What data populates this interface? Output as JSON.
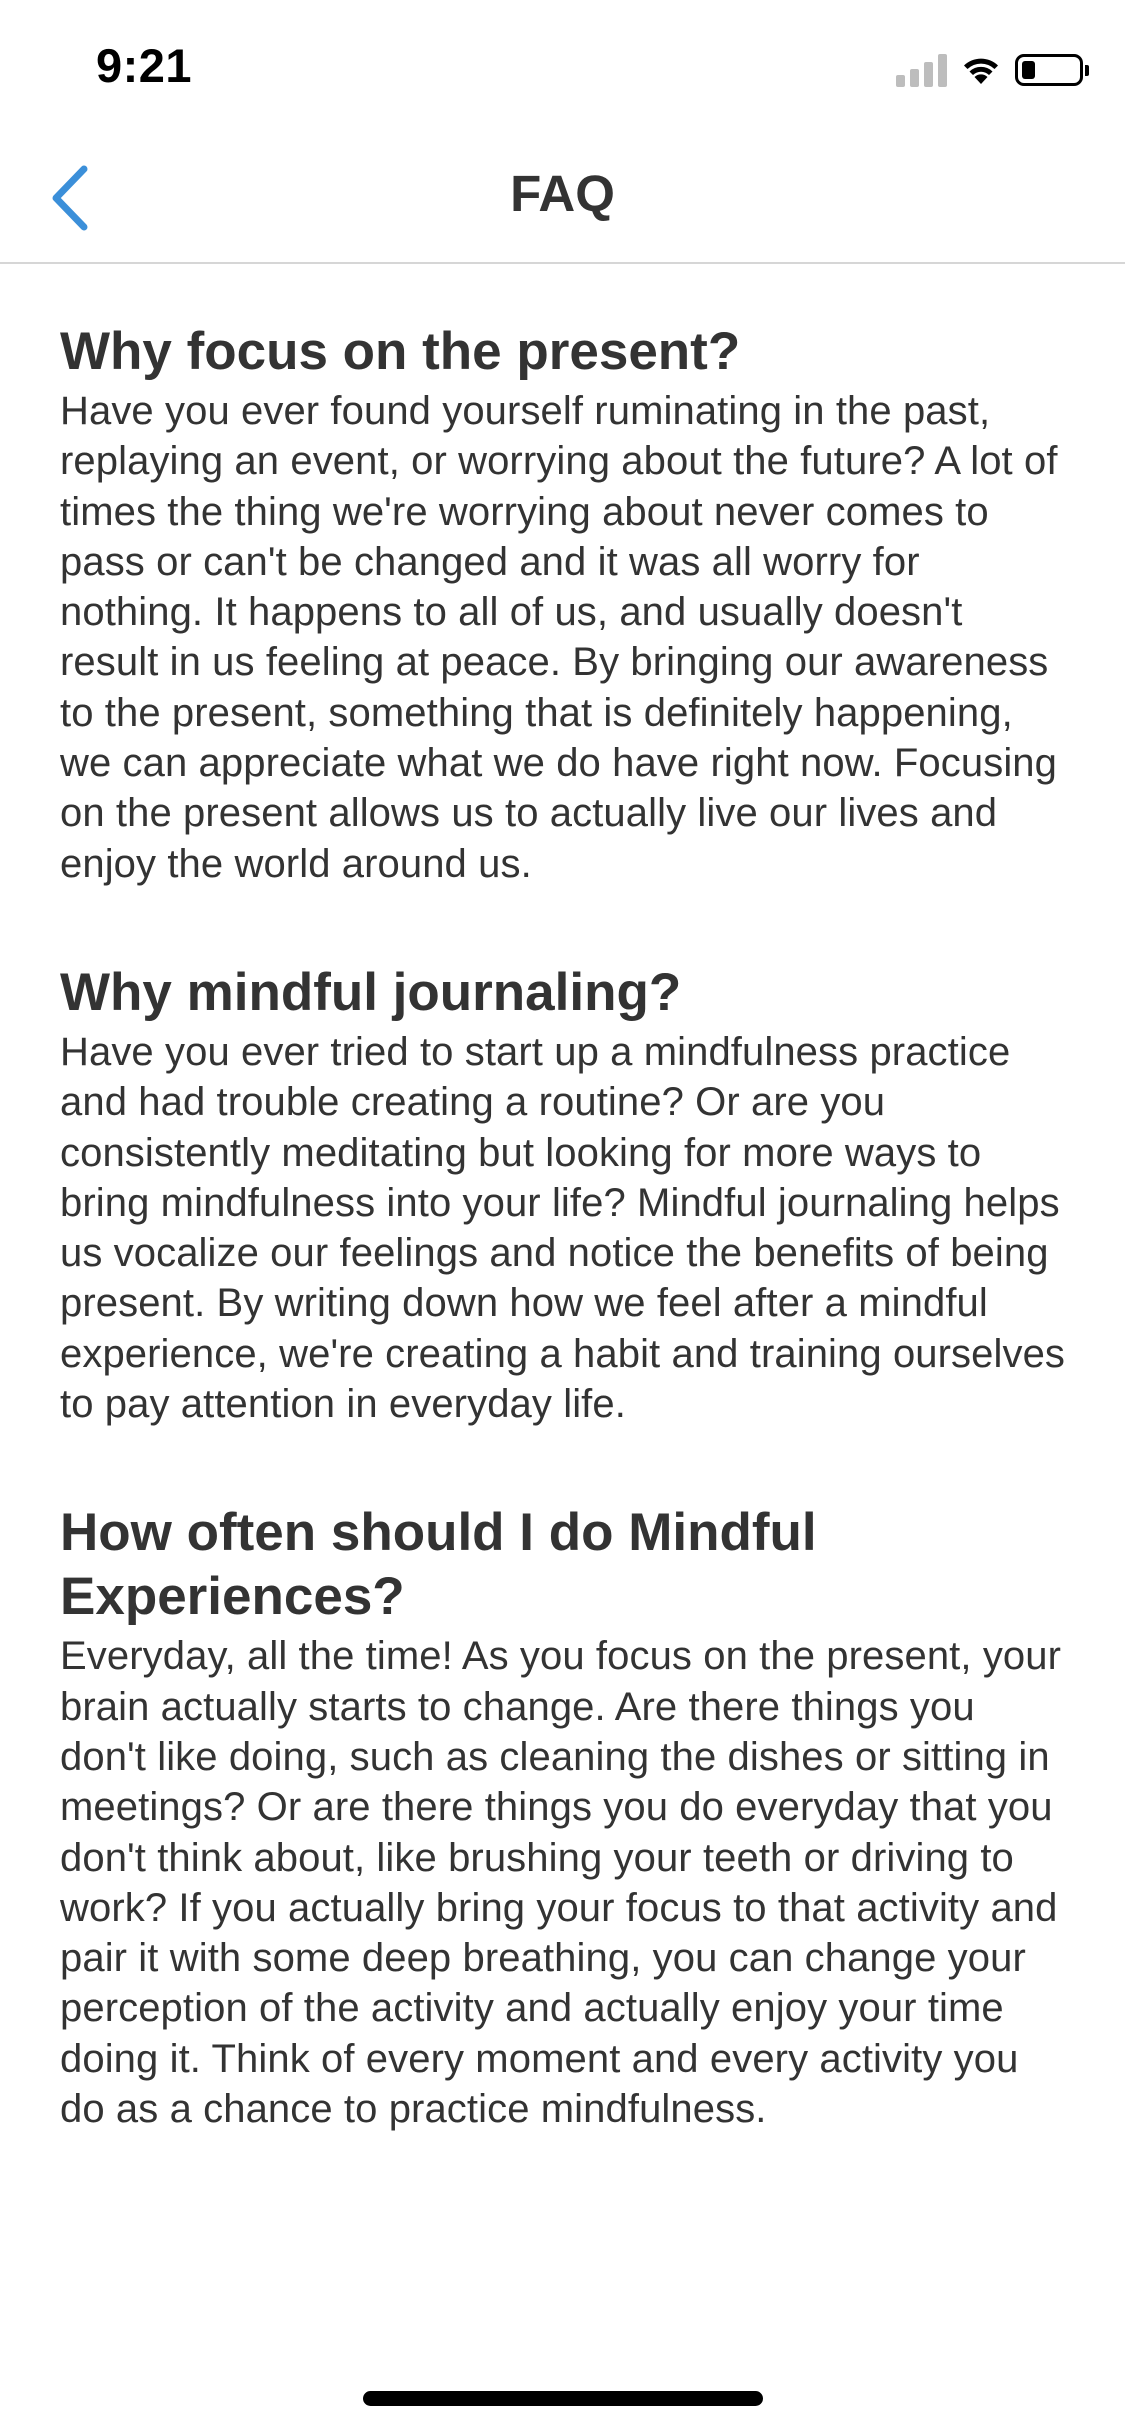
{
  "status_bar": {
    "time": "9:21",
    "icons": [
      "cellular-signal-icon",
      "wifi-icon",
      "battery-icon"
    ],
    "battery_level": 0.2
  },
  "nav": {
    "back_icon": "chevron-left-icon",
    "title": "FAQ",
    "accent_color": "#3b8fd9"
  },
  "faq": [
    {
      "question": "Why focus on the present?",
      "answer": "Have you ever found yourself ruminating in the past, replaying an event, or worrying about the future? A lot of times the thing we're worrying about never comes to pass or can't be changed and it was all worry for nothing. It happens to all of us, and usually doesn't result in us feeling at peace. By bringing our awareness to the present, something that is definitely happening, we can appreciate what we do have right now. Focusing on the present allows us to actually live our lives and enjoy the world around us."
    },
    {
      "question": "Why mindful journaling?",
      "answer": "Have you ever tried to start up a mindfulness practice and had trouble creating a routine? Or are you consistently meditating but looking for more ways to bring mindfulness into your life? Mindful journaling helps us vocalize our feelings and notice the benefits of being present. By writing down how we feel after a mindful experience, we're creating a habit and training ourselves to pay attention in everyday life."
    },
    {
      "question": "How often should I do Mindful Experiences?",
      "answer": "Everyday, all the time! As you focus on the present, your brain actually starts to change. Are there things you don't like doing, such as cleaning the dishes or sitting in meetings? Or are there things you do everyday that you don't think about, like brushing your teeth or driving to work? If you actually bring your focus to that activity and pair it with some deep breathing, you can change your perception of the activity and actually enjoy your time doing it. Think of every moment and every activity you do as a chance to practice mindfulness."
    }
  ]
}
